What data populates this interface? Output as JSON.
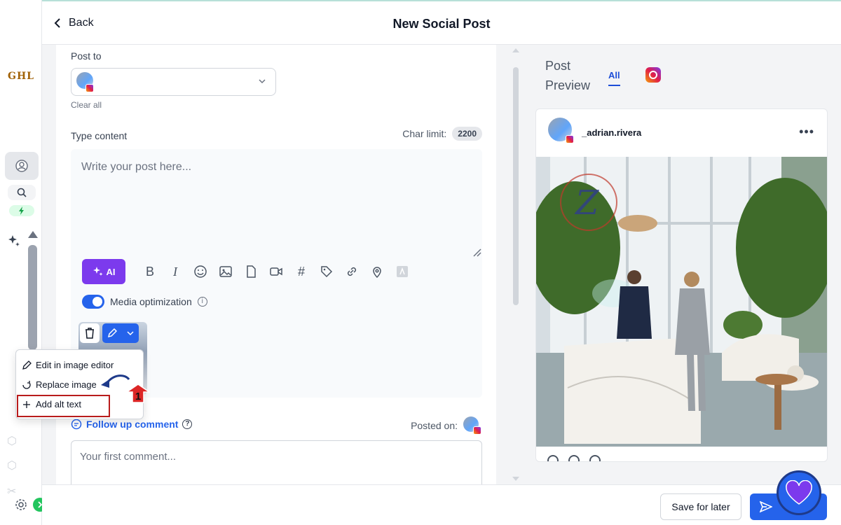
{
  "app": {
    "logo": "GHL"
  },
  "header": {
    "back_label": "Back",
    "title": "New Social Post"
  },
  "editor": {
    "post_to_label": "Post to",
    "clear_all": "Clear all",
    "type_content_label": "Type content",
    "char_limit_label": "Char limit:",
    "char_limit_value": "2200",
    "content_placeholder": "Write your post here...",
    "ai_label": "AI",
    "media_optimization_label": "Media optimization",
    "follow_up_label": "Follow up comment",
    "posted_on_label": "Posted on:",
    "comment_placeholder": "Your first comment..."
  },
  "image_menu": {
    "items": [
      {
        "label": "Edit in image editor",
        "icon": "pencil-icon"
      },
      {
        "label": "Replace image",
        "icon": "refresh-icon"
      },
      {
        "label": "Add alt text",
        "icon": "plus-icon"
      }
    ],
    "annotation_number": "1"
  },
  "preview": {
    "title": "Post Preview",
    "tab_all": "All",
    "username": "_adrian.rivera"
  },
  "footer": {
    "save_later": "Save for later"
  },
  "colors": {
    "primary": "#2563eb",
    "ai": "#7c3aed",
    "annotation": "#b91c1c"
  }
}
